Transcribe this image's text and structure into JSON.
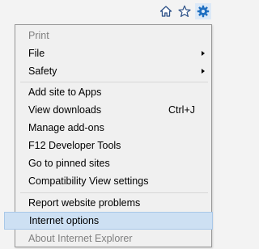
{
  "toolbar": {
    "icons": [
      "home-icon",
      "favorites-star-icon",
      "tools-gear-icon"
    ]
  },
  "menu": {
    "items": [
      {
        "label": "Print",
        "disabled": true
      },
      {
        "label": "File",
        "submenu": true
      },
      {
        "label": "Safety",
        "submenu": true
      },
      {
        "label": "Add site to Apps"
      },
      {
        "label": "View downloads",
        "shortcut": "Ctrl+J"
      },
      {
        "label": "Manage add-ons"
      },
      {
        "label": "F12 Developer Tools"
      },
      {
        "label": "Go to pinned sites"
      },
      {
        "label": "Compatibility View settings"
      },
      {
        "label": "Report website problems"
      },
      {
        "label": "Internet options",
        "highlighted": true
      },
      {
        "label": "About Internet Explorer",
        "disabled": true
      }
    ]
  },
  "colors": {
    "gear_accent": "#1f6fc1",
    "highlight": "#cde0f3",
    "disabled_text": "#808080"
  }
}
